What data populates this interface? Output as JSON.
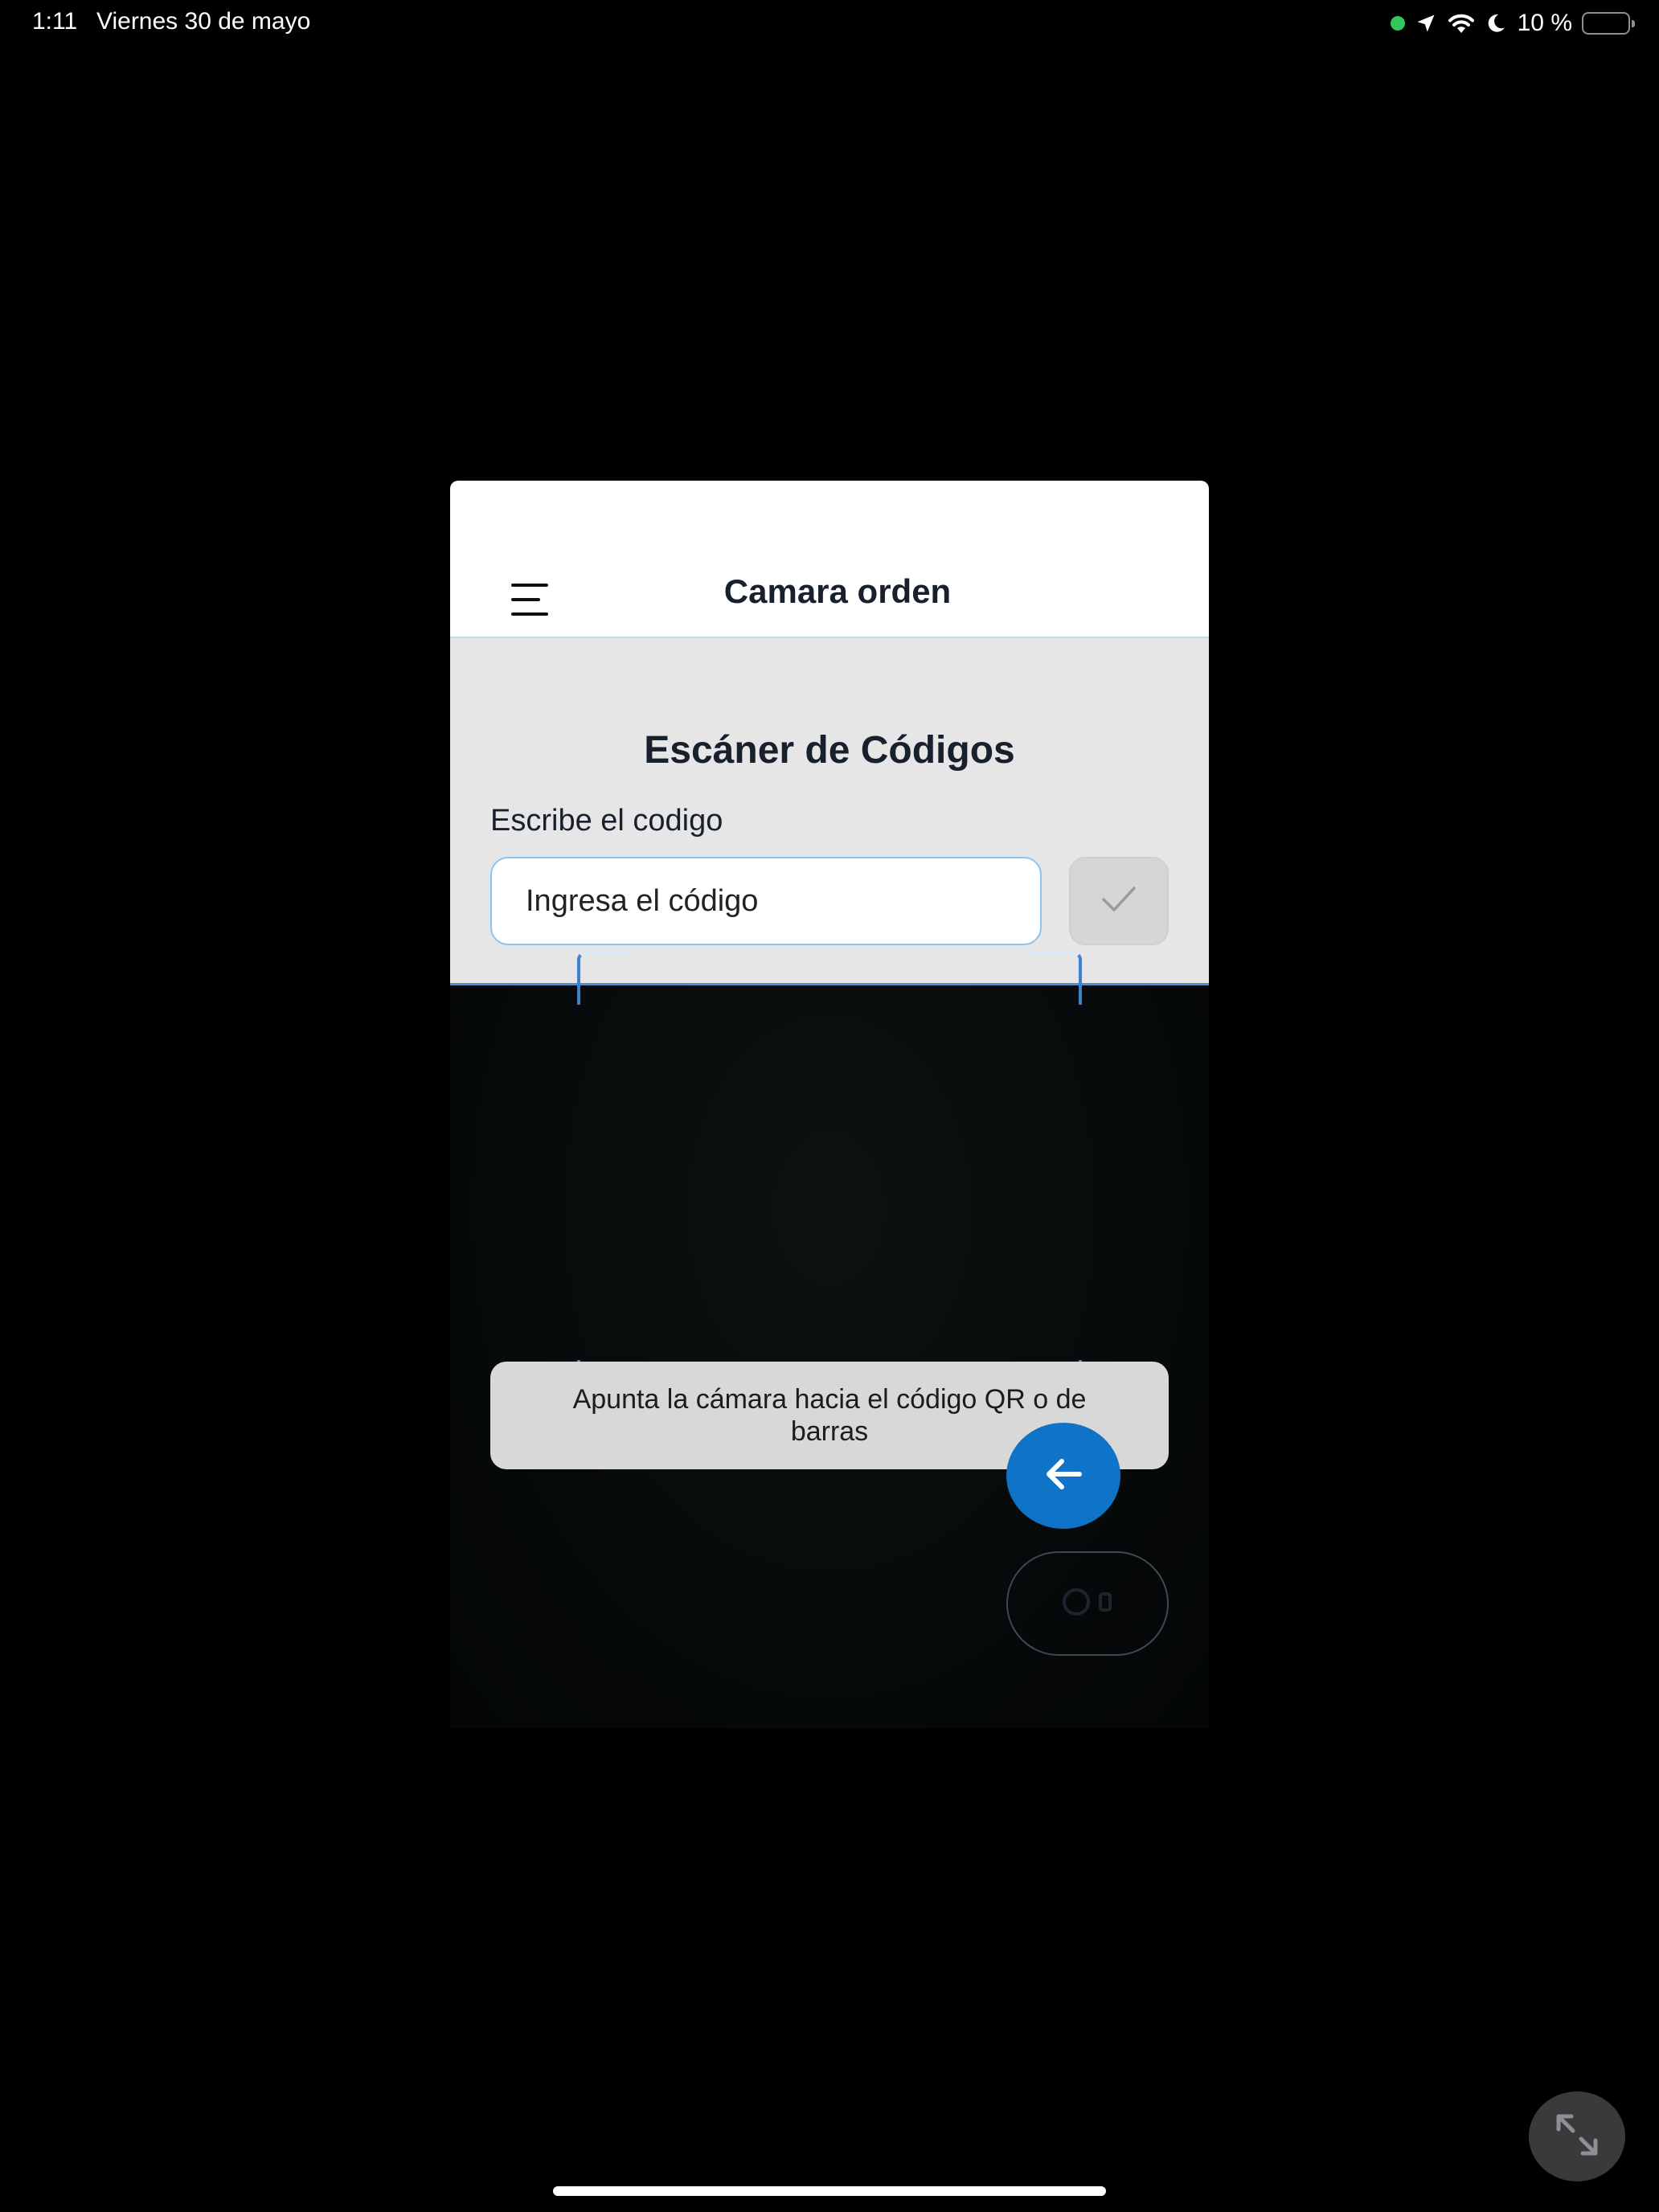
{
  "status_bar": {
    "time": "1:11",
    "date": "Viernes 30 de mayo",
    "battery_percent_text": "10 %",
    "battery_level": 0.1,
    "icons": [
      "camera-in-use-dot",
      "location-arrow-icon",
      "wifi-icon",
      "moon-icon",
      "battery-icon"
    ]
  },
  "header": {
    "title": "Camara orden",
    "menu_icon": "hamburger-menu-icon"
  },
  "scanner": {
    "title": "Escáner de Códigos",
    "input_label": "Escribe el codigo",
    "input_placeholder": "Ingresa el código",
    "confirm_icon": "checkmark-icon"
  },
  "camera": {
    "hint": "Apunta la cámara hacia el código QR o de barras",
    "back_icon": "arrow-left-icon",
    "torch_icon": "flashlight-icon"
  },
  "system": {
    "fullscreen_icon": "expand-icon"
  },
  "colors": {
    "accent": "#0f74c8",
    "scan_frame": "#3d80d4",
    "panel_bg": "#e6e6e6",
    "input_border": "#8cc4ee"
  }
}
